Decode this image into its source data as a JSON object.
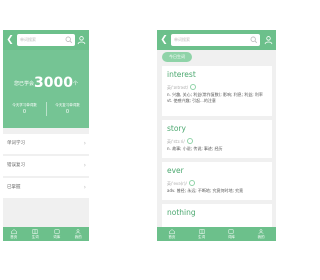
{
  "left_screen": {
    "search": {
      "placeholder": "单词搜索"
    },
    "hero": {
      "prefix": "您已学会",
      "count": "3000",
      "suffix": "个",
      "stats": [
        {
          "label": "今天学习单词数",
          "value": "0"
        },
        {
          "label": "今天复习单词数",
          "value": "0"
        }
      ]
    },
    "menu": [
      {
        "label": "单词学习"
      },
      {
        "label": "错误复习"
      },
      {
        "label": "已掌握"
      }
    ],
    "nav": [
      {
        "label": "首页",
        "icon": "home-icon"
      },
      {
        "label": "生词",
        "icon": "book-icon"
      },
      {
        "label": "词库",
        "icon": "library-icon"
      },
      {
        "label": "我的",
        "icon": "user-icon"
      }
    ]
  },
  "right_screen": {
    "search": {
      "placeholder": "单词搜索"
    },
    "tag": "今日生词",
    "words": [
      {
        "word": "interest",
        "phonetic": "英/ˈɪntrəst/",
        "definition": "n. 兴趣, 关心; 利益(常作复数); 影响; 利息; 利益; 利率 vt. 使感兴趣; 引起...的注意"
      },
      {
        "word": "story",
        "phonetic": "英/ˈstɔːri/",
        "definition": "n. 故事; 小说; 传说; 事迹; 经历"
      },
      {
        "word": "ever",
        "phonetic": "英/ˈevə(r)/",
        "definition": "adv. 曾经; 永远; 不断地; 究竟何时地; 究竟"
      },
      {
        "word": "nothing",
        "phonetic": "",
        "definition": ""
      }
    ],
    "nav": [
      {
        "label": "首页",
        "icon": "home-icon"
      },
      {
        "label": "生词",
        "icon": "book-icon"
      },
      {
        "label": "词库",
        "icon": "library-icon"
      },
      {
        "label": "我的",
        "icon": "user-icon"
      }
    ]
  },
  "colors": {
    "accent": "#6cc08b",
    "hero": "#75c494",
    "word": "#4ca870",
    "background": "#f0f0f0"
  }
}
